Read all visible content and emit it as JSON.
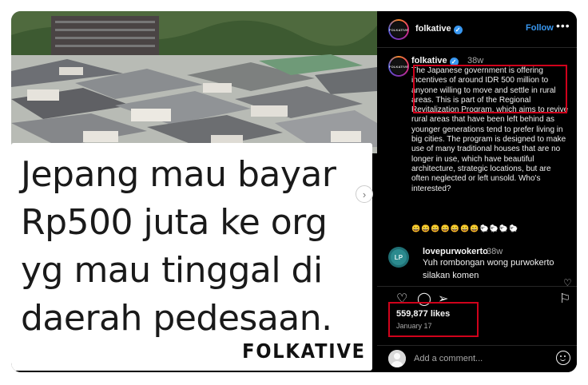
{
  "post": {
    "image_caption": "Jepang mau bayar\nRp500 juta ke org\nyg mau tinggal di\ndaerah pedesaan.",
    "watermark": "FOLKATIVE",
    "next_arrow": "›"
  },
  "header": {
    "username": "folkative",
    "verified_glyph": "✓",
    "follow_label": "Follow",
    "more_label": "•••",
    "avatar_text": "FOLKATIVE"
  },
  "main_comment": {
    "username": "folkative",
    "time": "38w",
    "text": "The Japanese government is offering incentives of around IDR 500 million to anyone willing to move and settle in rural areas. This is part of the Regional Revitalization Program, which aims to revive rural areas that have been left behind as younger generations tend to prefer living in big cities. The program is designed to make use of many traditional houses that are no longer in use, which have beautiful architecture, strategic locations, but are often neglected or left unsold. Who's interested?",
    "emojis": "😄😄😄😄😄😄😄🐑🐑🐑🐑"
  },
  "reply_comment": {
    "username": "lovepurwokerto",
    "time": "38w",
    "text": "Yuh rombongan wong purwokerto silakan komen",
    "avatar_text": "LP"
  },
  "actions": {
    "like_icon": "♡",
    "comment_icon": "◯",
    "share_icon": "➢",
    "save_icon": "⚐"
  },
  "stats": {
    "likes": "559,877 likes",
    "date": "January 17"
  },
  "composer": {
    "placeholder": "Add a comment..."
  },
  "colors": {
    "accent": "#3897f0",
    "highlight": "#d0021b",
    "panel_bg": "#000000"
  },
  "icons": [
    "heart-icon",
    "comment-icon",
    "share-icon",
    "bookmark-icon",
    "emoji-icon",
    "more-icon",
    "verified-icon",
    "chevron-right-icon"
  ]
}
